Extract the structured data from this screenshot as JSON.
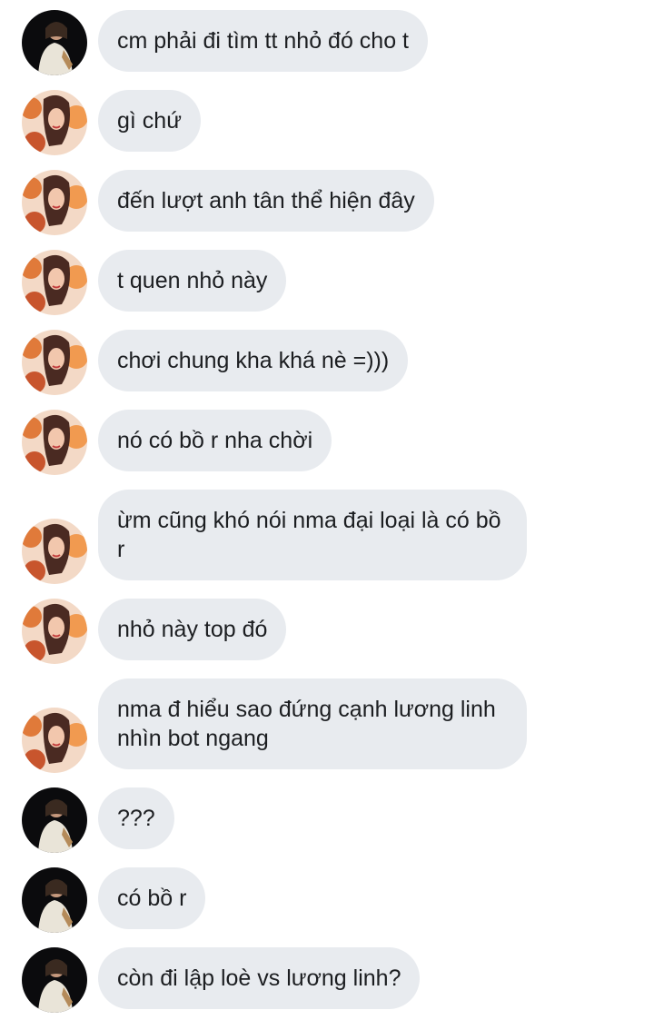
{
  "conversation": {
    "messages": [
      {
        "sender": "friend",
        "text": "cm phải đi tìm tt nhỏ đó cho t"
      },
      {
        "sender": "other",
        "text": "gì chứ"
      },
      {
        "sender": "other",
        "text": "đến lượt anh tân thể hiện đây"
      },
      {
        "sender": "other",
        "text": "t quen nhỏ này"
      },
      {
        "sender": "other",
        "text": "chơi chung kha khá nè =)))"
      },
      {
        "sender": "other",
        "text": "nó có bồ r nha chời"
      },
      {
        "sender": "other",
        "text": "ừm cũng khó nói nma đại loại là có bồ r"
      },
      {
        "sender": "other",
        "text": "nhỏ này top đó"
      },
      {
        "sender": "other",
        "text": "nma đ hiểu sao đứng cạnh lương linh nhìn bot ngang"
      },
      {
        "sender": "friend",
        "text": "???"
      },
      {
        "sender": "friend",
        "text": "có bồ r"
      },
      {
        "sender": "friend",
        "text": "còn đi lập loè vs lương linh?"
      }
    ]
  },
  "colors": {
    "bubble_bg": "#e8ebef",
    "text": "#1c1e21",
    "page_bg": "#ffffff"
  }
}
